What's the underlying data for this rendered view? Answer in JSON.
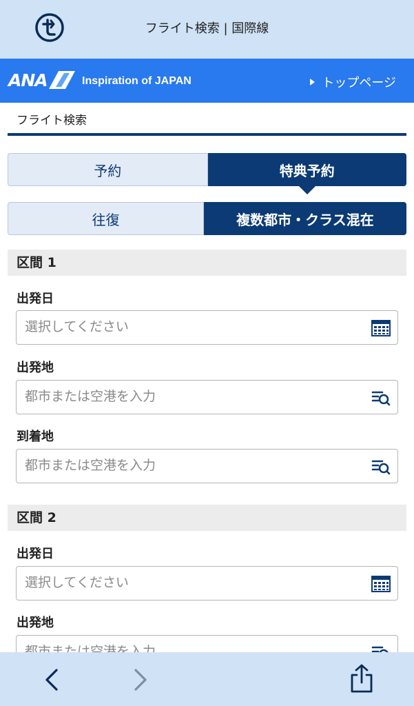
{
  "browser": {
    "title": "フライト検索 | 国際線"
  },
  "header": {
    "logo": "ANA",
    "tagline": "Inspiration of JAPAN",
    "top_link": "トップページ"
  },
  "breadcrumb": "フライト検索",
  "booking_type": {
    "options": [
      "予約",
      "特典予約"
    ],
    "selected": "特典予約"
  },
  "trip_type": {
    "options": [
      "往復",
      "複数都市・クラス混在"
    ],
    "selected": "複数都市・クラス混在"
  },
  "segments": [
    {
      "title": "区間 1",
      "departure_date": {
        "label": "出発日",
        "placeholder": "選択してください"
      },
      "origin": {
        "label": "出発地",
        "placeholder": "都市または空港を入力"
      },
      "destination": {
        "label": "到着地",
        "placeholder": "都市または空港を入力"
      }
    },
    {
      "title": "区間 2",
      "departure_date": {
        "label": "出発日",
        "placeholder": "選択してください"
      },
      "origin": {
        "label": "出発地",
        "placeholder": "都市または空港を入力"
      }
    }
  ],
  "colors": {
    "browser_bar": "#cfe2f6",
    "ana_blue": "#2979ef",
    "navy": "#0b3a74",
    "section_bg": "#ececec"
  },
  "icons": {
    "site": "site-t-icon",
    "calendar": "calendar-icon",
    "search_list": "list-search-icon",
    "back": "chevron-left-icon",
    "forward": "chevron-right-icon",
    "share": "share-icon"
  }
}
